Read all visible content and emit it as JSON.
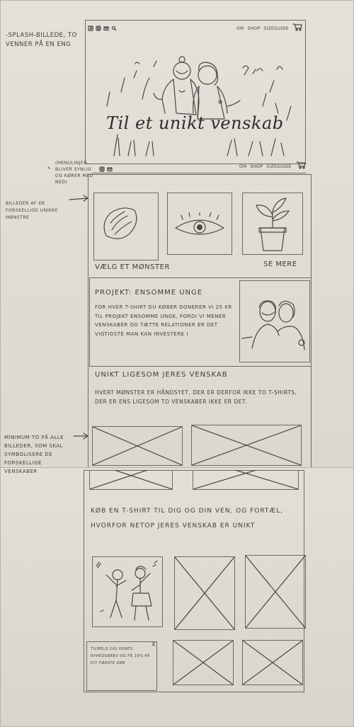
{
  "notes": {
    "splash": "-SPLASH-BILLEDE, TO VENNER PÅ EN ENG",
    "menu": "(MENULINJEN BLIVER SYNLIG OG KØRER MED NED)",
    "billeder": "BILLEDER AF DE FORSKELLIGE UNIKKE MØNSTRE",
    "minimum": "MINIMUM TO PÅ ALLE BILLEDER, SOM SKAL SYMBOLISERE DE FORSKELLIGE VENSKABER"
  },
  "nav": {
    "links": [
      "OM",
      "SHOP",
      "SIZEGUIDE"
    ],
    "icons": [
      "facebook-icon",
      "instagram-icon",
      "mail-icon",
      "search-icon",
      "cart-icon"
    ]
  },
  "hero": {
    "title": "Til et unikt venskab"
  },
  "patterns": {
    "choose": "VÆLG ET MØNSTER",
    "more": "SE MERE"
  },
  "project": {
    "title": "PROJEKT: ENSOMME UNGE",
    "text": "FOR HVER T-SHIRT DU KØBER DONERER VI 25 KR TIL PROJEKT ENSOMME UNGE, FORDI VI MENER VENSKABER OG TÆTTE RELATIONER ER DET VIGTIGSTE MAN KAN INVESTERE I"
  },
  "unique": {
    "title": "UNIKT LIGESOM JERES VENSKAB",
    "text": "HVERT MØNSTER ER HÅNDSYET, DER ER DERFOR IKKE TO T-SHIRTS, DER ER ENS LIGESOM TO VENSKABER IKKE ER DET."
  },
  "buy": {
    "text": "KØB EN T-SHIRT TIL DIG OG DIN VEN, OG FORTÆL, HVORFOR NETOP JERES VENSKAB ER UNIKT"
  },
  "newsletter": {
    "text": "TILMELD DIG VORES NYHEDSBREV OG FÅ 10% PÅ DIT FØRSTE KØB",
    "close": "x"
  },
  "colors": {
    "paper": "#e4e1da",
    "pencil": "#4a4743",
    "background": "#d8d4cb"
  }
}
